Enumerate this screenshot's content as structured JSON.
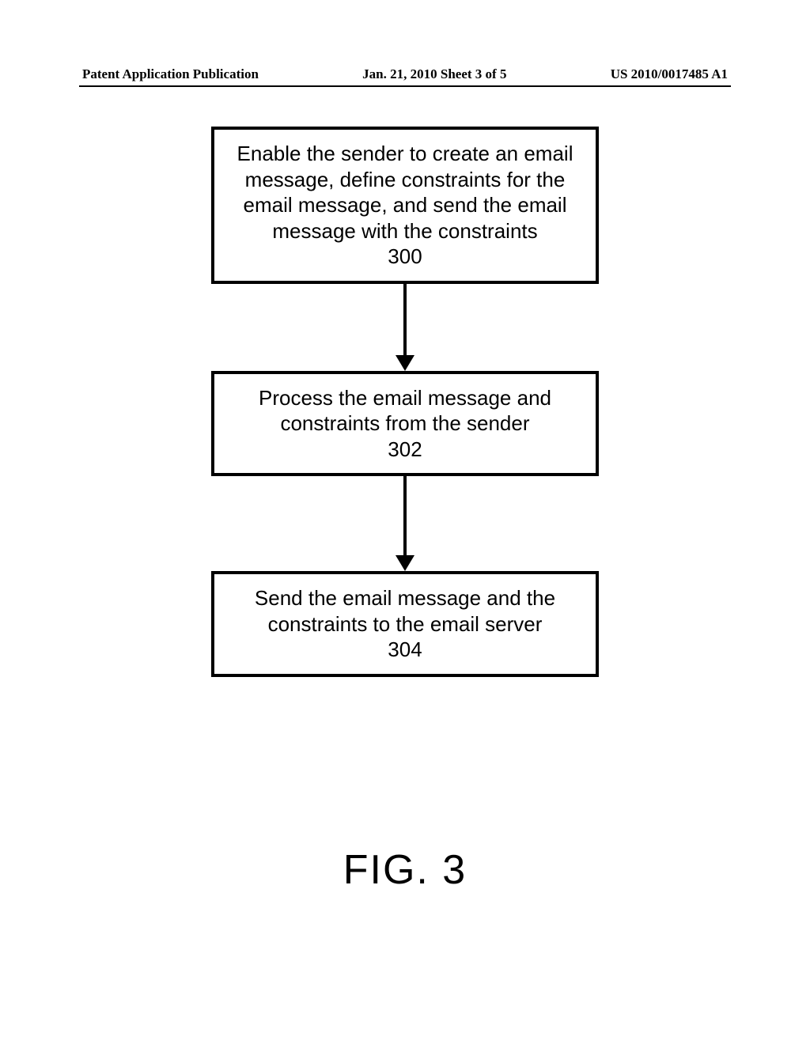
{
  "header": {
    "left": "Patent Application Publication",
    "middle": "Jan. 21, 2010  Sheet 3 of 5",
    "right": "US 2010/0017485 A1"
  },
  "flow": {
    "steps": [
      {
        "text": "Enable the sender to create an email message, define constraints for the email message, and send the email message with the constraints",
        "num": "300"
      },
      {
        "text": "Process the email message and constraints from the sender",
        "num": "302"
      },
      {
        "text": "Send the email message and the constraints to the email server",
        "num": "304"
      }
    ]
  },
  "figure_label": "FIG. 3",
  "chart_data": {
    "type": "flowchart",
    "title": "FIG. 3",
    "direction": "top-to-bottom",
    "nodes": [
      {
        "id": "300",
        "label": "Enable the sender to create an email message, define constraints for the email message, and send the email message with the constraints",
        "shape": "process"
      },
      {
        "id": "302",
        "label": "Process the email message and constraints from the sender",
        "shape": "process"
      },
      {
        "id": "304",
        "label": "Send the email message and the constraints to the email server",
        "shape": "process"
      }
    ],
    "edges": [
      {
        "from": "300",
        "to": "302",
        "style": "solid-arrow"
      },
      {
        "from": "302",
        "to": "304",
        "style": "solid-arrow"
      }
    ]
  }
}
